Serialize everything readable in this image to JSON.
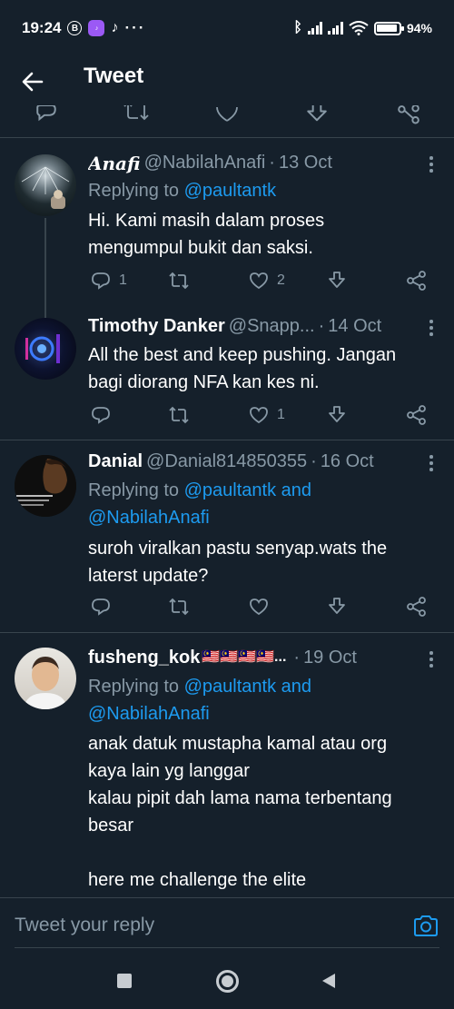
{
  "status_bar": {
    "time": "19:24",
    "badge": "B",
    "app_label": "HiFi Lab",
    "dots": "···",
    "battery": "94",
    "battery_level": 0.94
  },
  "header": {
    "title": "Tweet"
  },
  "tweets": [
    {
      "name": "Anafi",
      "handle": "@NabilahAnafi",
      "date": "13 Oct",
      "replying_prefix": "Replying to ",
      "replying_to": "@paultantk",
      "text": "Hi. Kami masih dalam proses\nmengumpul bukit dan saksi.",
      "replies": "1",
      "retweets": "",
      "likes": "2"
    },
    {
      "name": "Timothy Danker",
      "handle": "@Snapp...",
      "date": "14 Oct",
      "text": "All the best and keep pushing. Jangan\nbagi diorang NFA kan kes ni.",
      "replies": "",
      "retweets": "",
      "likes": "1"
    },
    {
      "name": "Danial",
      "handle": "@Danial814850355",
      "date": "16 Oct",
      "replying_prefix": "Replying to ",
      "replying_to": "@paultantk and",
      "replying_to_2": "@NabilahAnafi",
      "text": "suroh viralkan pastu senyap.wats the\nlaterst update?",
      "replies": "",
      "retweets": "",
      "likes": ""
    },
    {
      "name": "fusheng_kok",
      "name_suffix": "🇲🇾🇲🇾🇲🇾🇲🇾...",
      "date": "19 Oct",
      "replying_prefix": "Replying to ",
      "replying_to": "@paultantk and",
      "replying_to_2": "@NabilahAnafi",
      "text": "anak datuk mustapha kamal atau org\nkaya lain yg langgar\nkalau pipit dah lama nama terbentang\nbesar\n\nhere me challenge the elite"
    }
  ],
  "reply_bar": {
    "placeholder": "Tweet your reply"
  },
  "colors": {
    "background": "#15202b",
    "border": "#38444d",
    "muted": "#8899a6",
    "accent": "#1d9bf0"
  },
  "icons": [
    "back-arrow-icon",
    "reply-icon",
    "retweet-icon",
    "like-icon",
    "download-icon",
    "share-icon",
    "more-icon",
    "camera-icon"
  ]
}
